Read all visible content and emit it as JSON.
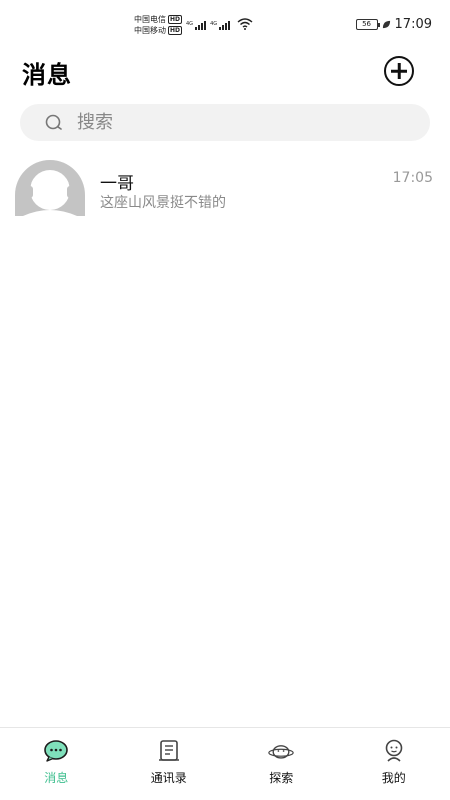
{
  "status_bar": {
    "carrier1": "中国电信",
    "carrier2": "中国移动",
    "hd": "HD",
    "net1": "4G",
    "net2": "4G",
    "battery": "56",
    "time": "17:09"
  },
  "header": {
    "title": "消息"
  },
  "search": {
    "placeholder": "搜索"
  },
  "conversations": [
    {
      "name": "一哥",
      "last_message": "这座山风景挺不错的",
      "time": "17:05"
    }
  ],
  "nav": {
    "items": [
      {
        "label": "消息",
        "icon": "chat-bubble-icon",
        "active": true
      },
      {
        "label": "通讯录",
        "icon": "contacts-icon",
        "active": false
      },
      {
        "label": "探索",
        "icon": "planet-icon",
        "active": false
      },
      {
        "label": "我的",
        "icon": "profile-icon",
        "active": false
      }
    ]
  },
  "colors": {
    "accent": "#3fbf8f",
    "search_bg": "#f2f2f2",
    "muted_text": "#8a8a8a"
  }
}
